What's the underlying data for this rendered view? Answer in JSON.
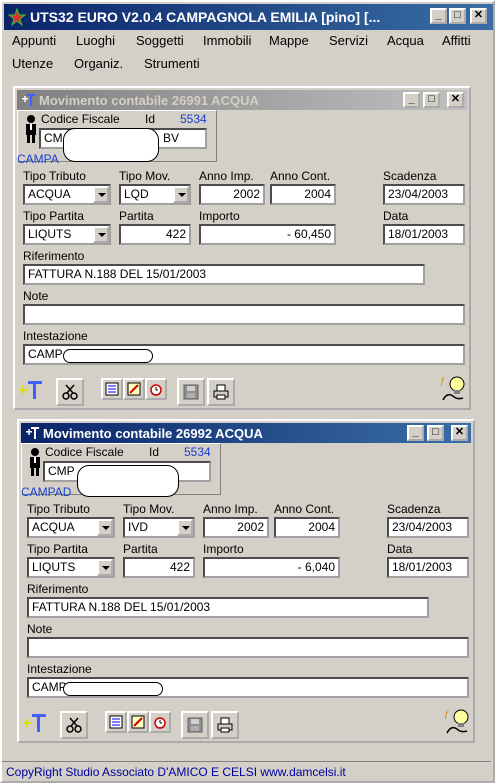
{
  "app": {
    "title": "UTS32 EURO V2.0.4 CAMPAGNOLA EMILIA [pino]  [..."
  },
  "menu": {
    "row1": [
      "Appunti",
      "Luoghi",
      "Soggetti",
      "Immobili",
      "Mappe",
      "Servizi",
      "Acqua",
      "Affitti"
    ],
    "row2": [
      "Utenze",
      "Organiz.",
      "Strumenti"
    ]
  },
  "windows": [
    {
      "title": "Movimento contabile 26991 ACQUA",
      "codice_fiscale_label": "Codice Fiscale",
      "id_label": "Id",
      "id_value": "5534",
      "cf_value_start": "CM",
      "cf_value_end": "BV",
      "name_partial": "CAMPA",
      "labels": {
        "tipo_tributo": "Tipo Tributo",
        "tipo_mov": "Tipo Mov.",
        "anno_imp": "Anno Imp.",
        "anno_cont": "Anno Cont.",
        "scadenza": "Scadenza",
        "tipo_partita": "Tipo Partita",
        "partita": "Partita",
        "importo": "Importo",
        "data": "Data",
        "riferimento": "Riferimento",
        "note": "Note",
        "intestazione": "Intestazione"
      },
      "values": {
        "tipo_tributo": "ACQUA",
        "tipo_mov": "LQD",
        "anno_imp": "2002",
        "anno_cont": "2004",
        "scadenza": "23/04/2003",
        "tipo_partita": "LIQUTS",
        "partita": "422",
        "importo": "- 60,450",
        "data": "18/01/2003",
        "riferimento": "FATTURA N.188 DEL 15/01/2003",
        "note": "",
        "intestazione": "CAMP"
      }
    },
    {
      "title": "Movimento contabile 26992 ACQUA",
      "codice_fiscale_label": "Codice Fiscale",
      "id_label": "Id",
      "id_value": "5534",
      "cf_value_start": "CMP",
      "cf_value_end": "",
      "name_partial": "CAMPAD",
      "labels": {
        "tipo_tributo": "Tipo Tributo",
        "tipo_mov": "Tipo Mov.",
        "anno_imp": "Anno Imp.",
        "anno_cont": "Anno Cont.",
        "scadenza": "Scadenza",
        "tipo_partita": "Tipo Partita",
        "partita": "Partita",
        "importo": "Importo",
        "data": "Data",
        "riferimento": "Riferimento",
        "note": "Note",
        "intestazione": "Intestazione"
      },
      "values": {
        "tipo_tributo": "ACQUA",
        "tipo_mov": "IVD",
        "anno_imp": "2002",
        "anno_cont": "2004",
        "scadenza": "23/04/2003",
        "tipo_partita": "LIQUTS",
        "partita": "422",
        "importo": "- 6,040",
        "data": "18/01/2003",
        "riferimento": "FATTURA N.188 DEL 15/01/2003",
        "note": "",
        "intestazione": "CAMP"
      }
    }
  ],
  "status": {
    "text": "CopyRight Studio Associato D'AMICO E CELSI  www.damcelsi.it"
  },
  "colors": {
    "title_active": "#0a246a",
    "title_inactive": "#808080",
    "id_blue": "#1a3fd0",
    "status_text": "#0000a0"
  }
}
